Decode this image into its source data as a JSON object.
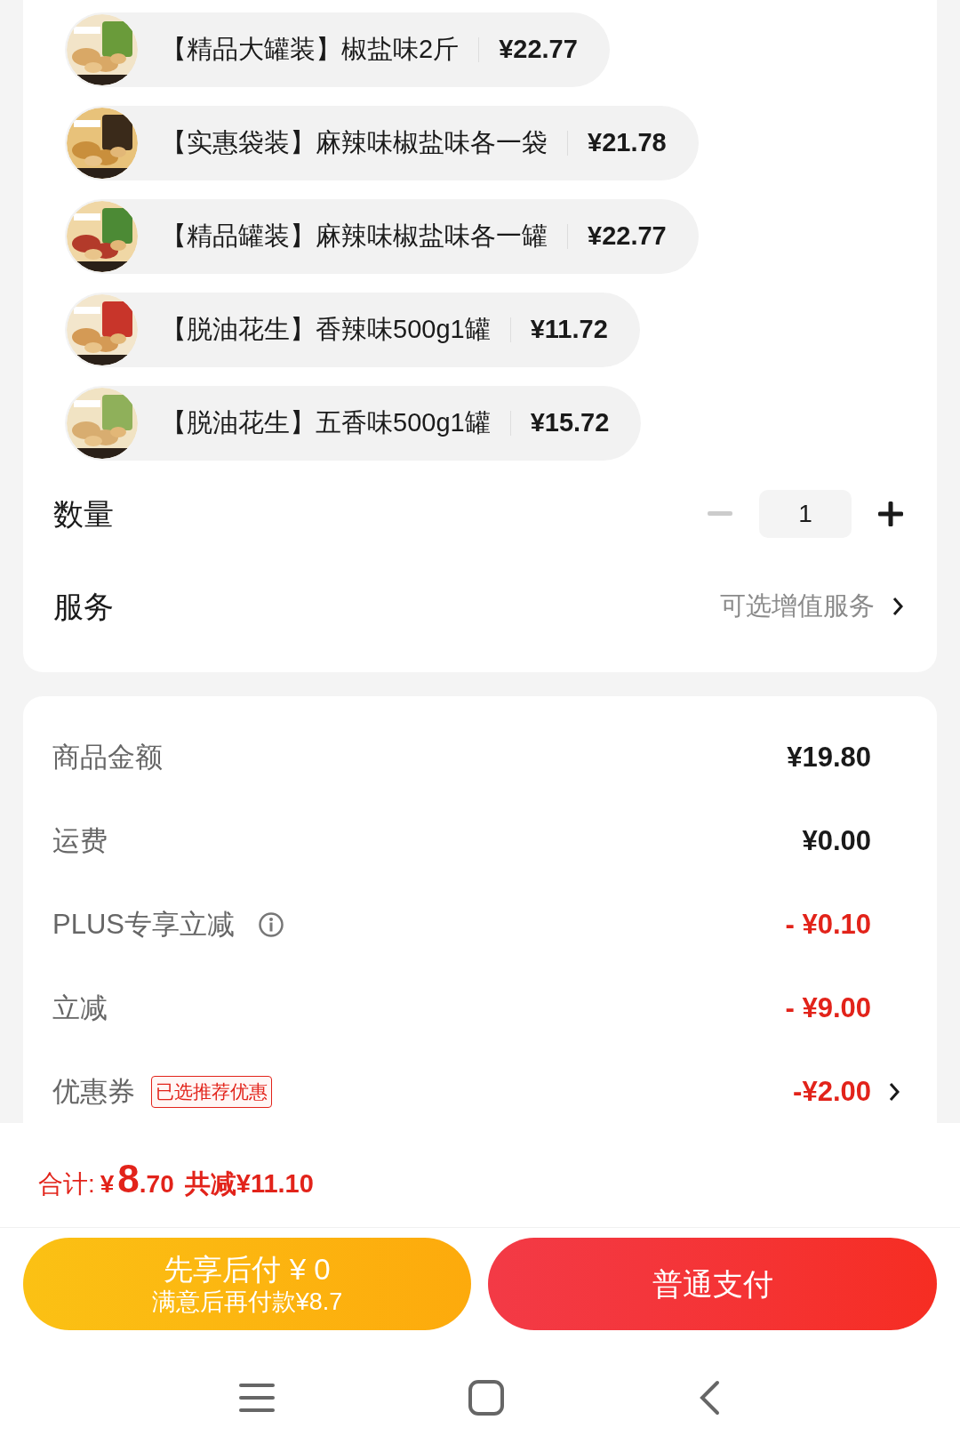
{
  "variants": [
    {
      "label": "【精品大罐装】椒盐味2斤",
      "price": "¥22.77"
    },
    {
      "label": "【实惠袋装】麻辣味椒盐味各一袋",
      "price": "¥21.78"
    },
    {
      "label": "【精品罐装】麻辣味椒盐味各一罐",
      "price": "¥22.77"
    },
    {
      "label": "【脱油花生】香辣味500g1罐",
      "price": "¥11.72"
    },
    {
      "label": "【脱油花生】五香味500g1罐",
      "price": "¥15.72"
    }
  ],
  "quantity": {
    "label": "数量",
    "value": "1",
    "decrease_disabled": true
  },
  "service": {
    "label": "服务",
    "value": "可选增值服务"
  },
  "summary": [
    {
      "label": "商品金额",
      "value": "¥19.80",
      "kind": "amount"
    },
    {
      "label": "运费",
      "value": "¥0.00",
      "kind": "amount"
    },
    {
      "label": "PLUS专享立减",
      "value": "- ¥0.10",
      "kind": "discount",
      "info": true
    },
    {
      "label": "立减",
      "value": "- ¥9.00",
      "kind": "discount"
    },
    {
      "label": "优惠券",
      "value": "-¥2.00",
      "kind": "discount",
      "tag": "已选推荐优惠",
      "link": true
    }
  ],
  "total": {
    "label": "合计:",
    "currency": "¥",
    "integer": "8",
    "decimal": ".70",
    "saving": "共减¥11.10"
  },
  "pay_later": {
    "title": "先享后付 ¥ 0",
    "subtitle": "满意后再付款¥8.7"
  },
  "pay_now": {
    "label": "普通支付"
  }
}
